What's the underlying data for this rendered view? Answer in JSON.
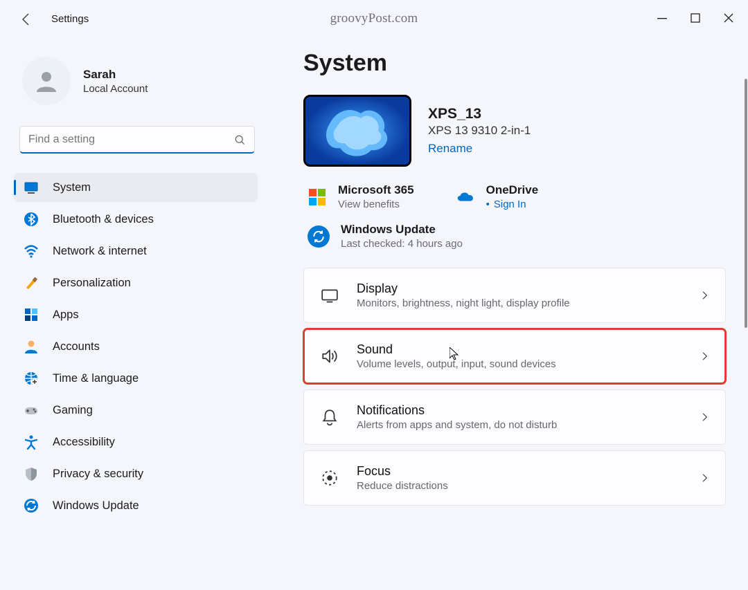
{
  "titlebar": {
    "label": "Settings",
    "watermark": "groovyPost.com"
  },
  "profile": {
    "name": "Sarah",
    "subtitle": "Local Account"
  },
  "search": {
    "placeholder": "Find a setting"
  },
  "nav": [
    {
      "key": "system",
      "label": "System",
      "selected": true,
      "icon": "system"
    },
    {
      "key": "bluetooth",
      "label": "Bluetooth & devices",
      "icon": "bluetooth"
    },
    {
      "key": "network",
      "label": "Network & internet",
      "icon": "wifi"
    },
    {
      "key": "personalization",
      "label": "Personalization",
      "icon": "brush"
    },
    {
      "key": "apps",
      "label": "Apps",
      "icon": "apps"
    },
    {
      "key": "accounts",
      "label": "Accounts",
      "icon": "person"
    },
    {
      "key": "time",
      "label": "Time & language",
      "icon": "globe"
    },
    {
      "key": "gaming",
      "label": "Gaming",
      "icon": "gamepad"
    },
    {
      "key": "accessibility",
      "label": "Accessibility",
      "icon": "accessibility"
    },
    {
      "key": "privacy",
      "label": "Privacy & security",
      "icon": "shield"
    },
    {
      "key": "update",
      "label": "Windows Update",
      "icon": "sync"
    }
  ],
  "page": {
    "title": "System"
  },
  "device": {
    "name": "XPS_13",
    "model": "XPS 13 9310 2-in-1",
    "rename": "Rename"
  },
  "services": {
    "m365": {
      "title": "Microsoft 365",
      "sub": "View benefits"
    },
    "onedrive": {
      "title": "OneDrive",
      "sub": "Sign In"
    },
    "update": {
      "title": "Windows Update",
      "sub": "Last checked: 4 hours ago"
    }
  },
  "cards": [
    {
      "key": "display",
      "title": "Display",
      "sub": "Monitors, brightness, night light, display profile",
      "icon": "display",
      "highlight": false
    },
    {
      "key": "sound",
      "title": "Sound",
      "sub": "Volume levels, output, input, sound devices",
      "icon": "sound",
      "highlight": true,
      "cursor": true
    },
    {
      "key": "notifications",
      "title": "Notifications",
      "sub": "Alerts from apps and system, do not disturb",
      "icon": "bell",
      "highlight": false
    },
    {
      "key": "focus",
      "title": "Focus",
      "sub": "Reduce distractions",
      "icon": "focus",
      "highlight": false
    }
  ]
}
